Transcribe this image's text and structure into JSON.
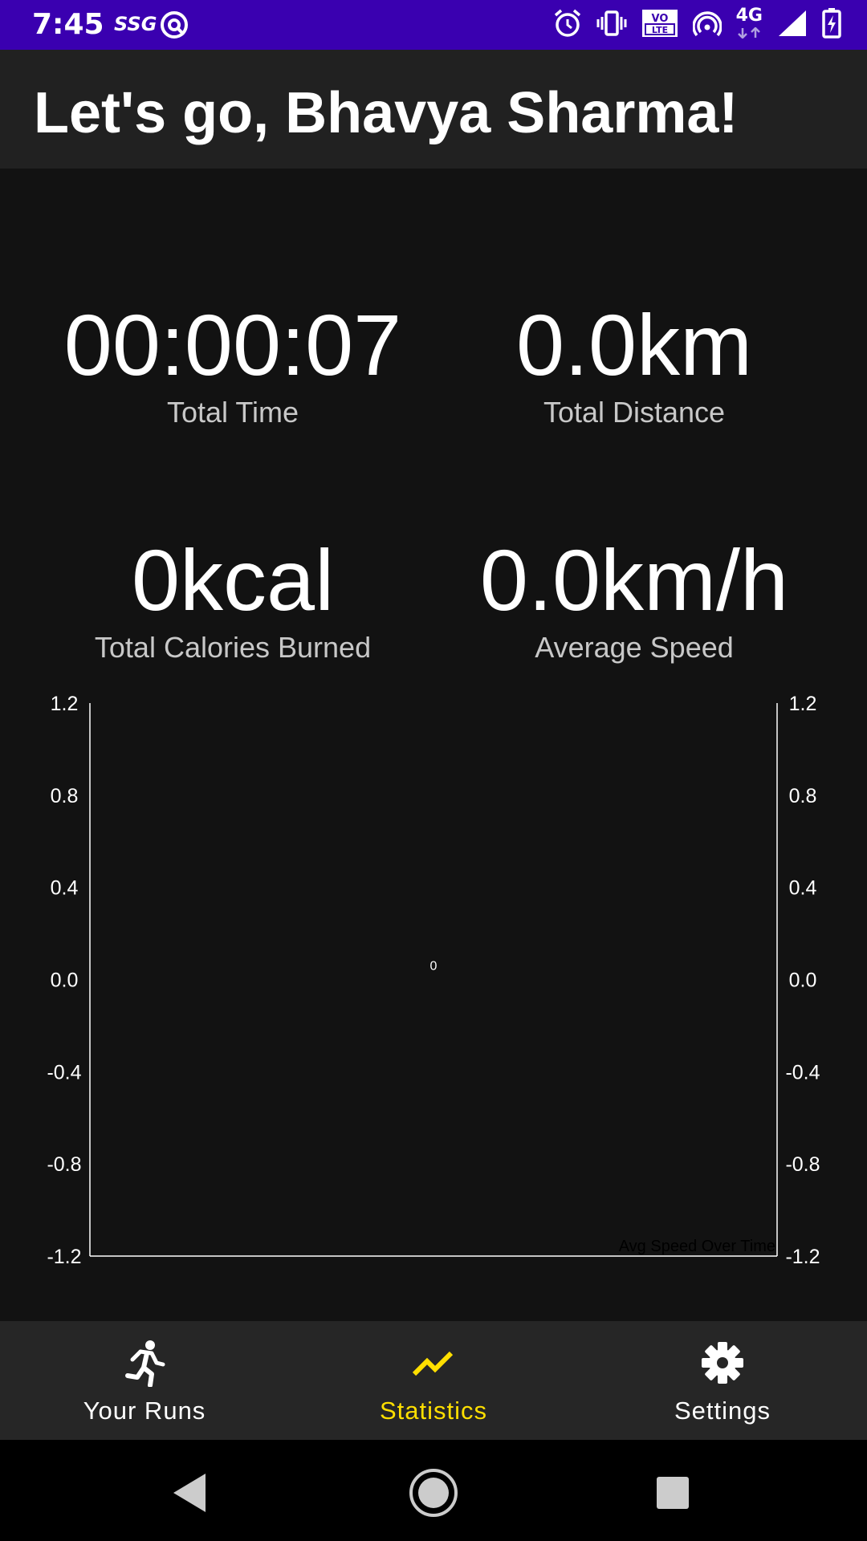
{
  "status_bar": {
    "time": "7:45",
    "carrier_badge": "SSG",
    "network": "4G",
    "icons": [
      "data-saver-icon",
      "alarm-icon",
      "vibrate-icon",
      "volte-icon",
      "hotspot-icon",
      "signal-icon",
      "battery-charging-icon"
    ],
    "volte_top": "VO",
    "volte_bottom": "LTE"
  },
  "app_bar": {
    "title": "Let's go, Bhavya Sharma!"
  },
  "stats": {
    "total_time": {
      "value": "00:00:07",
      "label": "Total Time"
    },
    "total_distance": {
      "value": "0.0km",
      "label": "Total Distance"
    },
    "total_calories": {
      "value": "0kcal",
      "label": "Total Calories Burned"
    },
    "average_speed": {
      "value": "0.0km/h",
      "label": "Average Speed"
    }
  },
  "chart_data": {
    "type": "bar",
    "categories": [
      "0"
    ],
    "values": [
      0
    ],
    "description_label": "Avg Speed Over Time",
    "ylim": [
      -1.2,
      1.2
    ],
    "y_ticks": [
      "1.2",
      "0.8",
      "0.4",
      "0.0",
      "-0.4",
      "-0.8",
      "-1.2"
    ],
    "grid": false
  },
  "bottom_nav": {
    "items": [
      {
        "label": "Your Runs",
        "icon": "runner-icon",
        "active": false
      },
      {
        "label": "Statistics",
        "icon": "trending-up-icon",
        "active": true
      },
      {
        "label": "Settings",
        "icon": "gear-icon",
        "active": false
      }
    ],
    "active_color": "#ffdf00"
  },
  "system_nav": {
    "buttons": [
      "back-icon",
      "home-icon",
      "recents-icon"
    ]
  }
}
